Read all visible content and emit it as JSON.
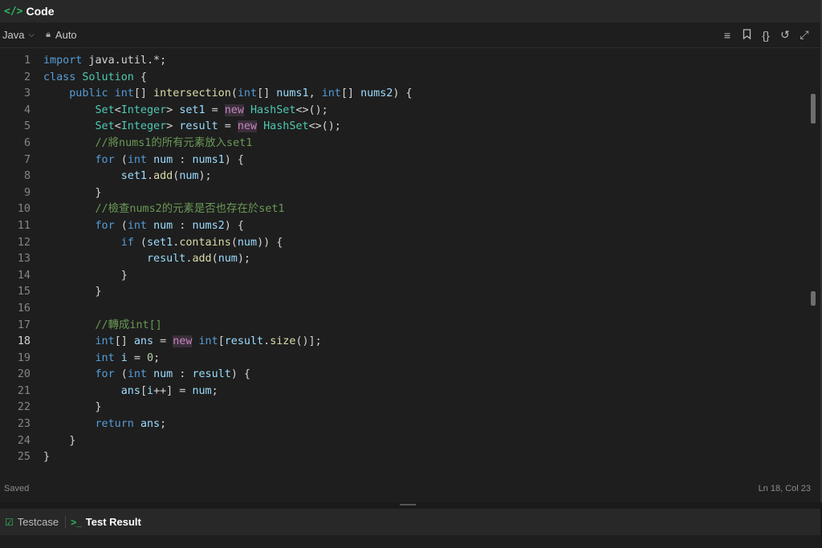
{
  "header": {
    "title": "Code",
    "icon": "code-icon"
  },
  "toolbar": {
    "language": "Java",
    "mode": "Auto"
  },
  "toolbar_icons": [
    "format-icon",
    "bookmark-icon",
    "braces-icon",
    "reset-icon",
    "expand-icon"
  ],
  "editor": {
    "active_line": 18,
    "lines": [
      "1",
      "2",
      "3",
      "4",
      "5",
      "6",
      "7",
      "8",
      "9",
      "10",
      "11",
      "12",
      "13",
      "14",
      "15",
      "16",
      "17",
      "18",
      "19",
      "20",
      "21",
      "22",
      "23",
      "24",
      "25"
    ],
    "code": {
      "l1": "import java.util.*;",
      "l2": "class Solution {",
      "l6": "//將nums1的所有元素放入set1",
      "l10": "//檢查nums2的元素是否也存在於set1",
      "l17": "//轉成int[]"
    }
  },
  "status": {
    "saved": "Saved",
    "cursor": "Ln 18, Col 23"
  },
  "bottom_tabs": {
    "testcase": "Testcase",
    "test_result": "Test Result"
  },
  "colors": {
    "accent": "#2cbb5d",
    "keyword": "#569cd6",
    "type": "#4ec9b0",
    "function": "#dcdcaa",
    "variable": "#9cdcfe",
    "comment": "#6a9955"
  }
}
